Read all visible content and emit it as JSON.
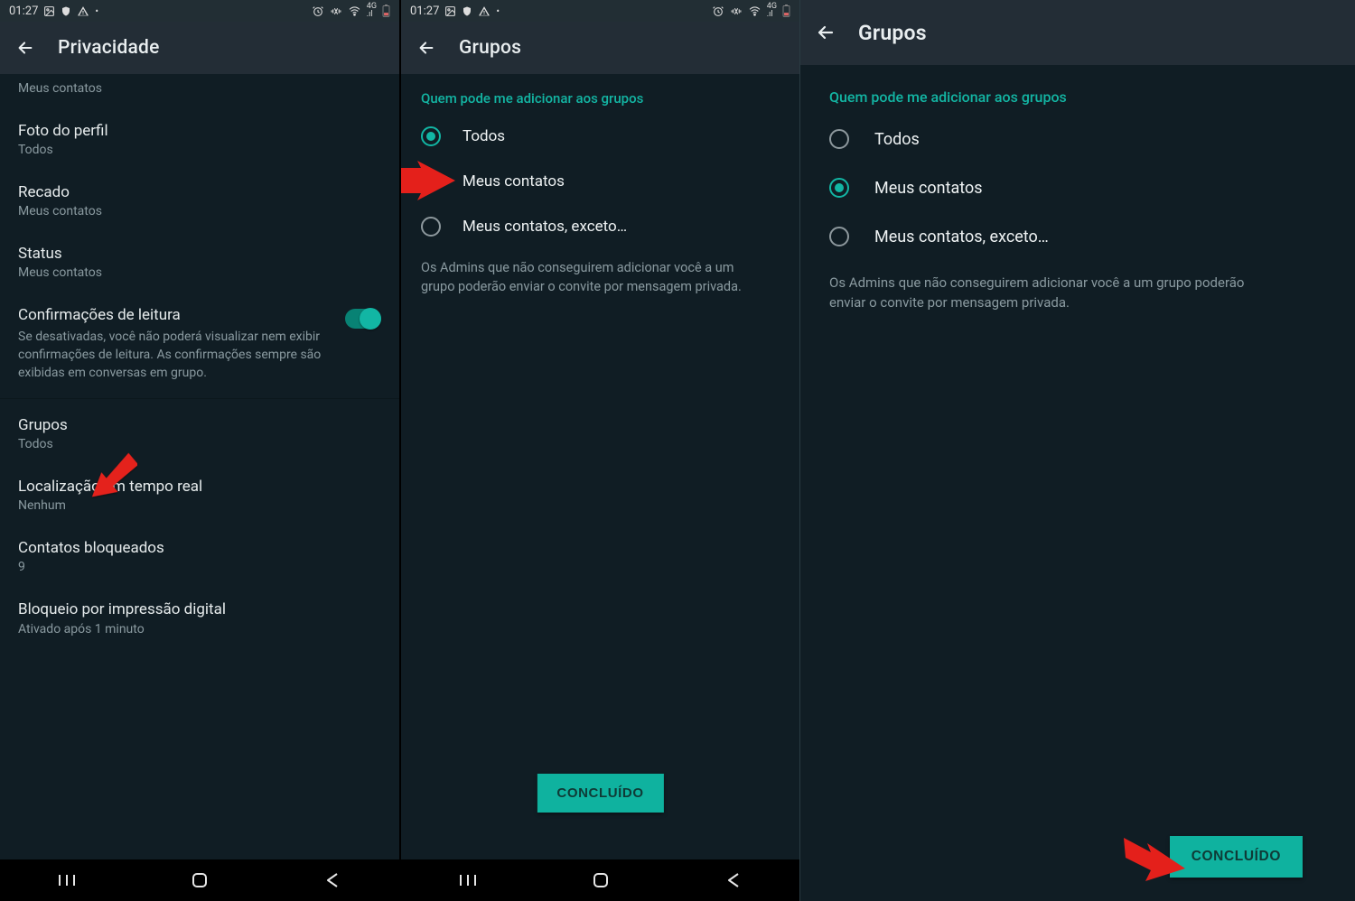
{
  "status": {
    "time": "01:27"
  },
  "panel1": {
    "appbar_title": "Privacidade",
    "last_seen_sub": "Meus contatos",
    "profile_photo": {
      "title": "Foto do perfil",
      "sub": "Todos"
    },
    "about": {
      "title": "Recado",
      "sub": "Meus contatos"
    },
    "status_item": {
      "title": "Status",
      "sub": "Meus contatos"
    },
    "read_receipts": {
      "title": "Confirmações de leitura",
      "desc": "Se desativadas, você não poderá visualizar nem exibir confirmações de leitura. As confirmações sempre são exibidas em conversas em grupo."
    },
    "groups": {
      "title": "Grupos",
      "sub": "Todos"
    },
    "live_location": {
      "title": "Localização em tempo real",
      "sub": "Nenhum"
    },
    "blocked_contacts": {
      "title": "Contatos bloqueados",
      "sub": "9"
    },
    "fingerprint": {
      "title": "Bloqueio por impressão digital",
      "sub": "Ativado após 1 minuto"
    }
  },
  "panel2": {
    "appbar_title": "Grupos",
    "section_header": "Quem pode me adicionar aos grupos",
    "options": {
      "everyone": "Todos",
      "my_contacts": "Meus contatos",
      "my_contacts_except": "Meus contatos, exceto…"
    },
    "selected": "everyone",
    "helper": "Os Admins que não conseguirem adicionar você a um grupo poderão enviar o convite por mensagem privada.",
    "done": "CONCLUÍDO"
  },
  "panel3": {
    "appbar_title": "Grupos",
    "section_header": "Quem pode me adicionar aos grupos",
    "options": {
      "everyone": "Todos",
      "my_contacts": "Meus contatos",
      "my_contacts_except": "Meus contatos, exceto…"
    },
    "selected": "my_contacts",
    "helper": "Os Admins que não conseguirem adicionar você a um grupo poderão enviar o convite por mensagem privada.",
    "done": "CONCLUÍDO"
  }
}
